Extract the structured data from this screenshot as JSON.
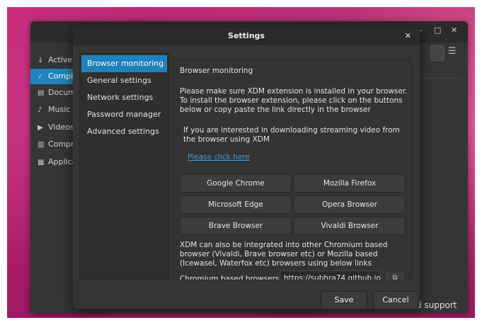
{
  "main_window": {
    "controls": {
      "minimize": "–",
      "maximize": "□",
      "close": "✕"
    },
    "menu_icon": "☰",
    "sidebar": [
      {
        "label": "Active",
        "icon": "↓"
      },
      {
        "label": "Complete",
        "icon": "✓"
      },
      {
        "label": "Documents",
        "icon": "▤"
      },
      {
        "label": "Music",
        "icon": "♪"
      },
      {
        "label": "Videos",
        "icon": "▶"
      },
      {
        "label": "Compressed",
        "icon": "▥"
      },
      {
        "label": "Applications",
        "icon": "▦"
      }
    ],
    "footer_text": "d support"
  },
  "dialog": {
    "title": "Settings",
    "close_icon": "✕",
    "nav": [
      "Browser monitoring",
      "General settings",
      "Network settings",
      "Password manager",
      "Advanced settings"
    ],
    "panel": {
      "heading": "Browser monitoring",
      "intro": "Please make sure XDM extension is installed in your browser. To install the browser extension, please click on the buttons below or copy paste the link directly in the browser",
      "streaming": "If you are interested in downloading streaming video from the browser using XDM",
      "link": "Please click here",
      "browsers": [
        "Google Chrome",
        "Mozilla Firefox",
        "Microsoft Edge",
        "Opera Browser",
        "Brave Browser",
        "Vivaldi Browser"
      ],
      "chromium_note": "XDM can also be integrated into other Chromium based browser (Vivaldi, Brave browser etc) or Mozilla based (Icewasel, Waterfox etc) browsers using below links",
      "chromium_label": "Chromium based browsers",
      "chromium_url": "https://subhra74.github.io",
      "copy_icon": "⧉"
    },
    "save_label": "Save",
    "cancel_label": "Cancel"
  }
}
